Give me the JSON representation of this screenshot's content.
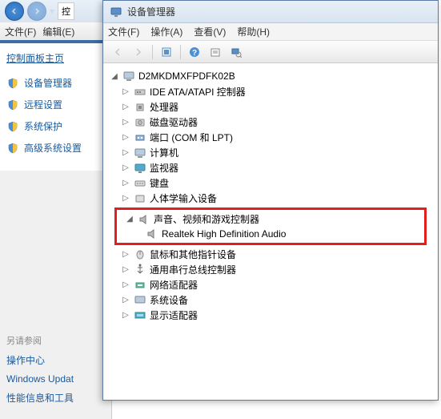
{
  "back_window": {
    "breadcrumb": "控",
    "menu_file": "文件(F)",
    "menu_edit": "编辑(E)",
    "cp_home": "控制面板主页",
    "items": [
      {
        "label": "设备管理器"
      },
      {
        "label": "远程设置"
      },
      {
        "label": "系统保护"
      },
      {
        "label": "高级系统设置"
      }
    ],
    "see_also": "另请参阅",
    "bottom_links": [
      "操作中心",
      "Windows Updat",
      "性能信息和工具"
    ]
  },
  "device_manager": {
    "title": "设备管理器",
    "menu": {
      "file": "文件(F)",
      "action": "操作(A)",
      "view": "查看(V)",
      "help": "帮助(H)"
    },
    "root": "D2MKDMXFPDFK02B",
    "categories": [
      {
        "label": "IDE ATA/ATAPI 控制器",
        "expanded": false
      },
      {
        "label": "处理器",
        "expanded": false
      },
      {
        "label": "磁盘驱动器",
        "expanded": false
      },
      {
        "label": "端口 (COM 和 LPT)",
        "expanded": false
      },
      {
        "label": "计算机",
        "expanded": false
      },
      {
        "label": "监视器",
        "expanded": false
      },
      {
        "label": "键盘",
        "expanded": false
      },
      {
        "label": "人体学输入设备",
        "expanded": false
      },
      {
        "label": "声音、视频和游戏控制器",
        "expanded": true,
        "highlighted": true,
        "children": [
          "Realtek High Definition Audio"
        ]
      },
      {
        "label": "鼠标和其他指针设备",
        "expanded": false
      },
      {
        "label": "通用串行总线控制器",
        "expanded": false
      },
      {
        "label": "网络适配器",
        "expanded": false
      },
      {
        "label": "系统设备",
        "expanded": false
      },
      {
        "label": "显示适配器",
        "expanded": false
      }
    ]
  }
}
